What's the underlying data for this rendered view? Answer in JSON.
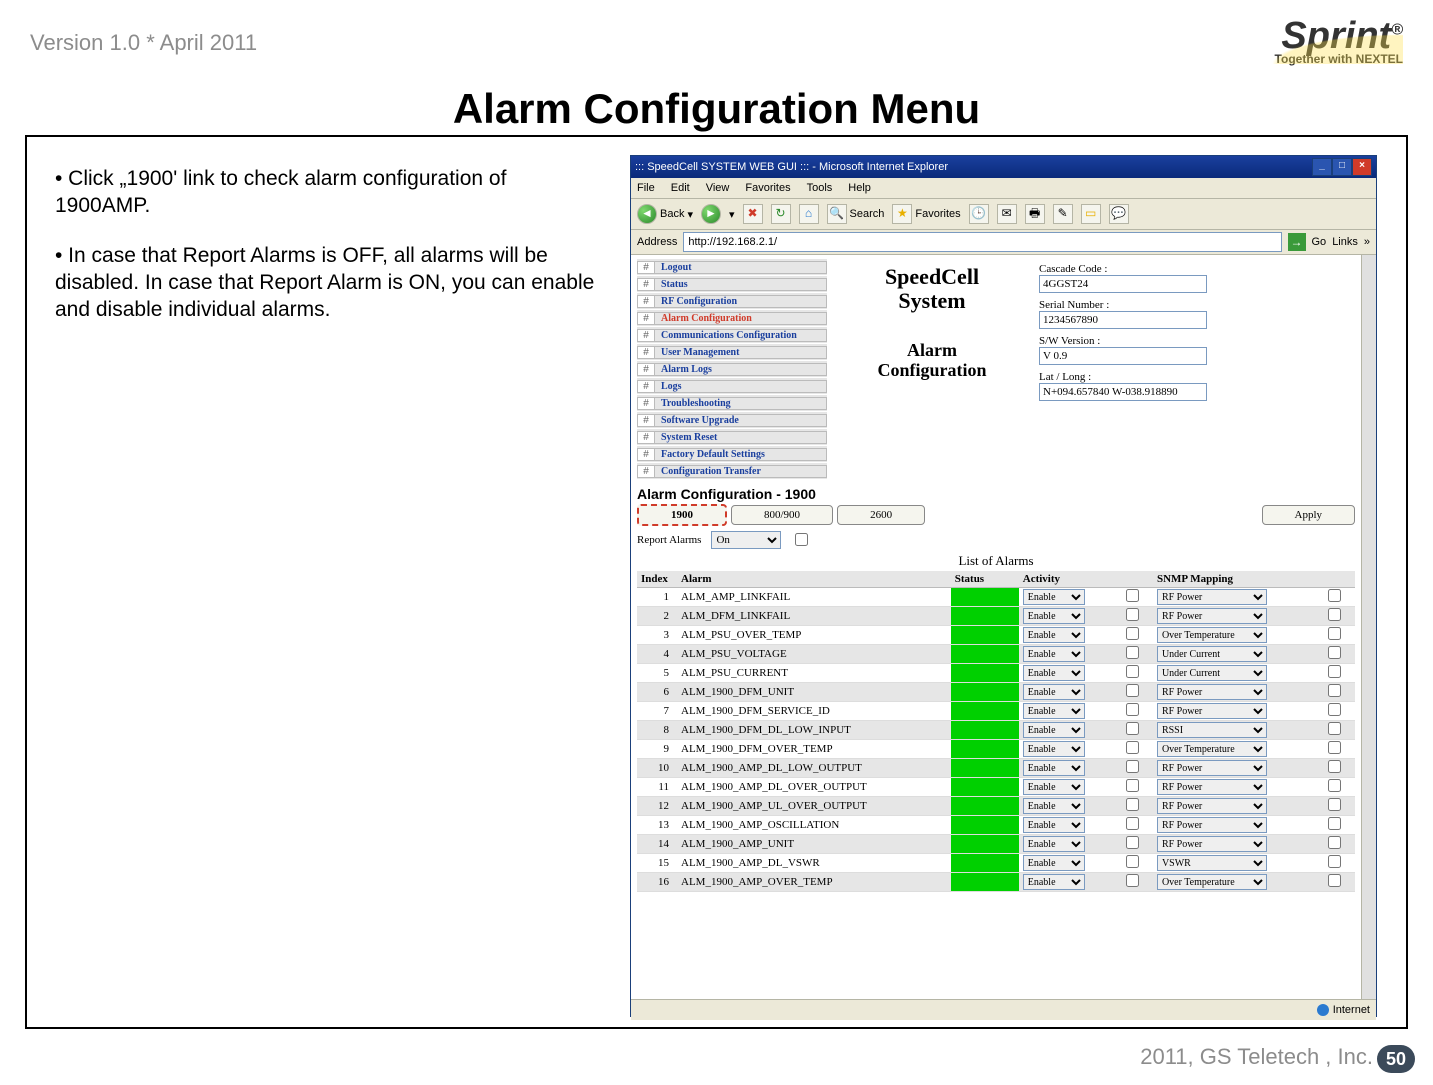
{
  "meta": {
    "version": "Version 1.0 * April 2011",
    "footer": "2011, GS Teletech , Inc.",
    "page_number": "50"
  },
  "logo": {
    "brand": "Sprint",
    "tag": "Together with NEXTEL"
  },
  "slide_title": "Alarm Configuration Menu",
  "instructions": {
    "p1": "• Click „1900' link to check alarm configuration of 1900AMP.",
    "p2": "• In case that Report Alarms is OFF, all alarms will be disabled. In case that Report Alarm is ON, you can enable and disable individual alarms."
  },
  "ie": {
    "title": "::: SpeedCell SYSTEM WEB GUI ::: - Microsoft Internet Explorer",
    "menus": [
      "File",
      "Edit",
      "View",
      "Favorites",
      "Tools",
      "Help"
    ],
    "toolbar": {
      "back": "Back",
      "search": "Search",
      "favorites": "Favorites"
    },
    "address_label": "Address",
    "address": "http://192.168.2.1/",
    "go": "Go",
    "links": "Links",
    "status_zone": "Internet"
  },
  "nav": [
    "Logout",
    "Status",
    "RF Configuration",
    "Alarm Configuration",
    "Communications Configuration",
    "User Management",
    "Alarm Logs",
    "Logs",
    "Troubleshooting",
    "Software Upgrade",
    "System Reset",
    "Factory Default Settings",
    "Configuration Transfer"
  ],
  "nav_active_index": 3,
  "header": {
    "banner1": "SpeedCell",
    "banner1b": "System",
    "banner2": "Alarm",
    "banner2b": "Configuration",
    "cascade_label": "Cascade Code :",
    "cascade": "4GGST24",
    "serial_label": "Serial Number :",
    "serial": "1234567890",
    "sw_label": "S/W Version :",
    "sw": "V 0.9",
    "ll_label": "Lat / Long :",
    "ll": "N+094.657840 W-038.918890"
  },
  "section": {
    "title": "Alarm Configuration - 1900",
    "tabs": [
      "1900",
      "800/900",
      "2600"
    ],
    "apply": "Apply",
    "report_label": "Report Alarms",
    "report_value": "On",
    "list_title": "List of Alarms",
    "columns": {
      "idx": "Index",
      "alarm": "Alarm",
      "status": "Status",
      "activity": "Activity",
      "map": "SNMP Mapping"
    }
  },
  "alarms": [
    {
      "i": 1,
      "n": "ALM_AMP_LINKFAIL",
      "a": "Enable",
      "m": "RF Power"
    },
    {
      "i": 2,
      "n": "ALM_DFM_LINKFAIL",
      "a": "Enable",
      "m": "RF Power"
    },
    {
      "i": 3,
      "n": "ALM_PSU_OVER_TEMP",
      "a": "Enable",
      "m": "Over Temperature"
    },
    {
      "i": 4,
      "n": "ALM_PSU_VOLTAGE",
      "a": "Enable",
      "m": "Under Current"
    },
    {
      "i": 5,
      "n": "ALM_PSU_CURRENT",
      "a": "Enable",
      "m": "Under Current"
    },
    {
      "i": 6,
      "n": "ALM_1900_DFM_UNIT",
      "a": "Enable",
      "m": "RF Power"
    },
    {
      "i": 7,
      "n": "ALM_1900_DFM_SERVICE_ID",
      "a": "Enable",
      "m": "RF Power"
    },
    {
      "i": 8,
      "n": "ALM_1900_DFM_DL_LOW_INPUT",
      "a": "Enable",
      "m": "RSSI"
    },
    {
      "i": 9,
      "n": "ALM_1900_DFM_OVER_TEMP",
      "a": "Enable",
      "m": "Over Temperature"
    },
    {
      "i": 10,
      "n": "ALM_1900_AMP_DL_LOW_OUTPUT",
      "a": "Enable",
      "m": "RF Power"
    },
    {
      "i": 11,
      "n": "ALM_1900_AMP_DL_OVER_OUTPUT",
      "a": "Enable",
      "m": "RF Power"
    },
    {
      "i": 12,
      "n": "ALM_1900_AMP_UL_OVER_OUTPUT",
      "a": "Enable",
      "m": "RF Power"
    },
    {
      "i": 13,
      "n": "ALM_1900_AMP_OSCILLATION",
      "a": "Enable",
      "m": "RF Power"
    },
    {
      "i": 14,
      "n": "ALM_1900_AMP_UNIT",
      "a": "Enable",
      "m": "RF Power"
    },
    {
      "i": 15,
      "n": "ALM_1900_AMP_DL_VSWR",
      "a": "Enable",
      "m": "VSWR"
    },
    {
      "i": 16,
      "n": "ALM_1900_AMP_OVER_TEMP",
      "a": "Enable",
      "m": "Over Temperature"
    }
  ]
}
